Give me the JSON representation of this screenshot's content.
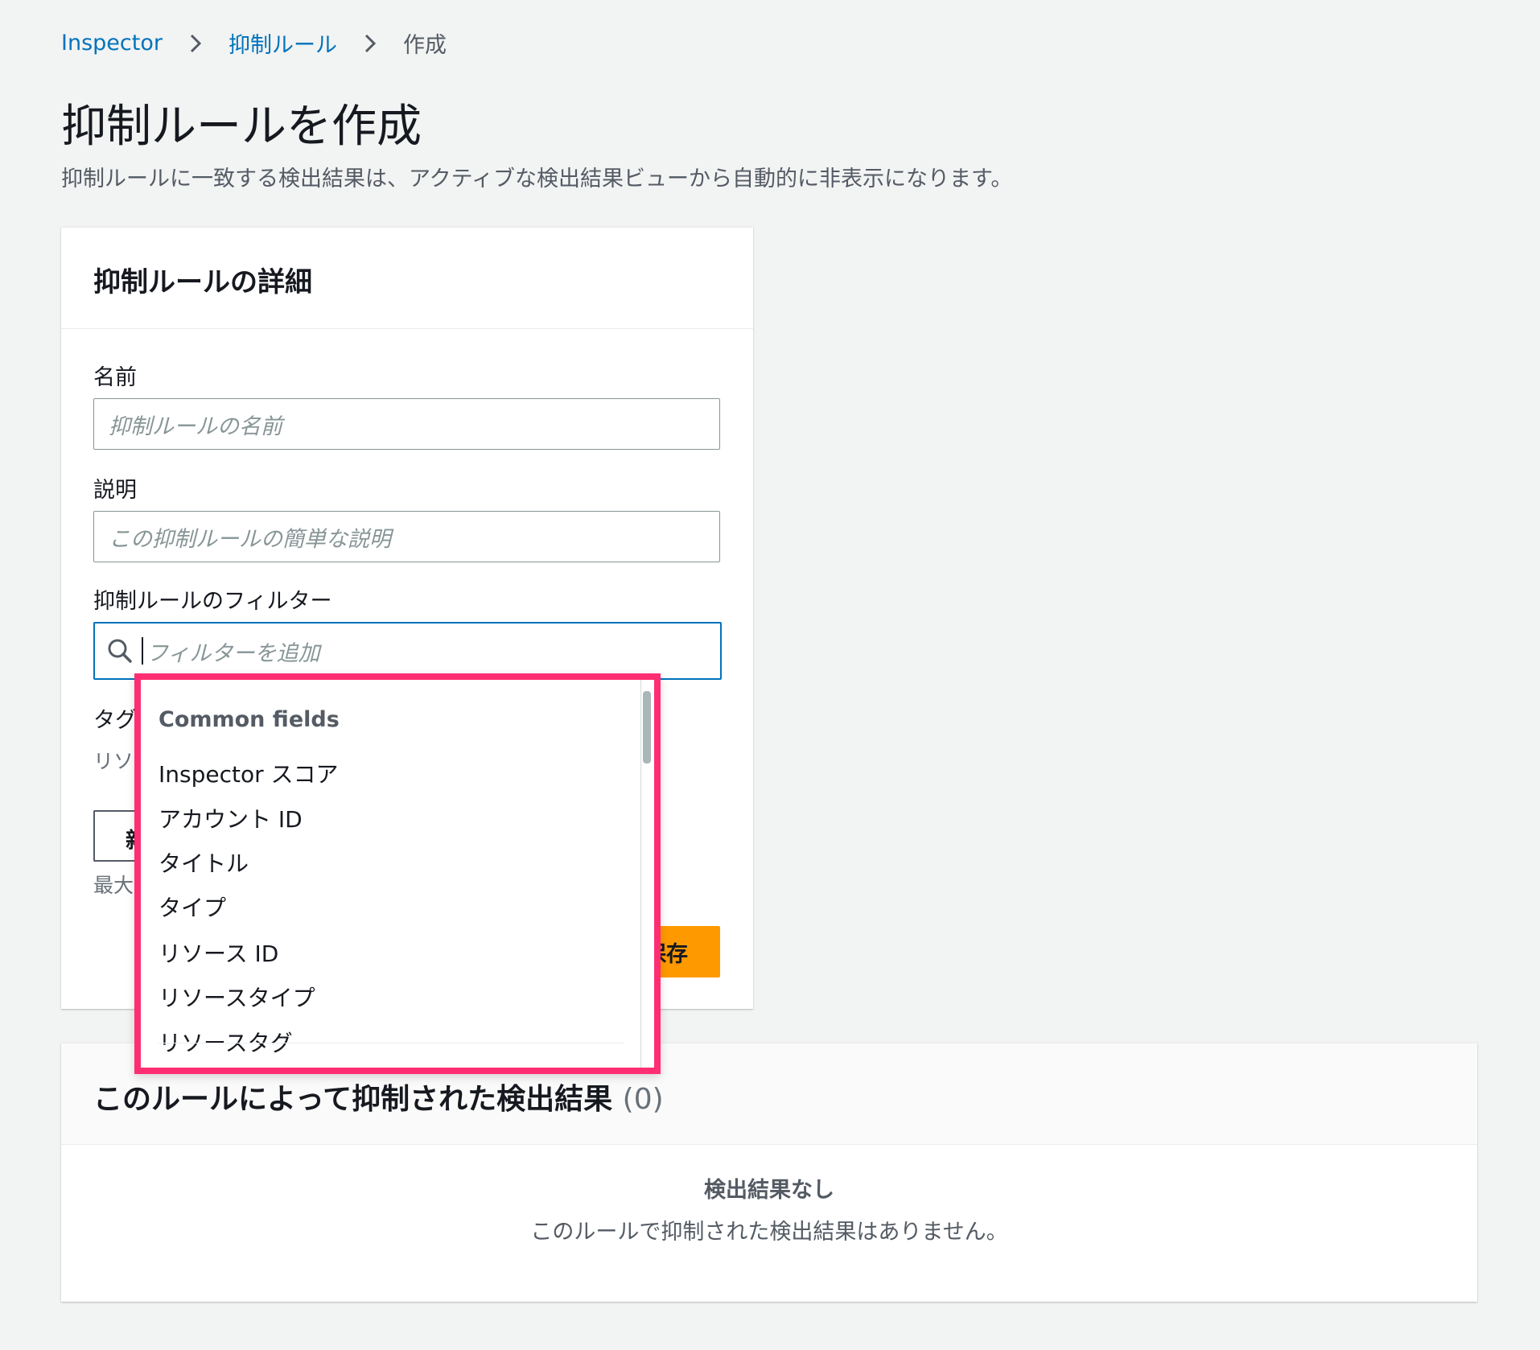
{
  "breadcrumb": {
    "items": [
      "Inspector",
      "抑制ルール",
      "作成"
    ]
  },
  "page": {
    "title": "抑制ルールを作成",
    "description": "抑制ルールに一致する検出結果は、アクティブな検出結果ビューから自動的に非表示になります。"
  },
  "details": {
    "header": "抑制ルールの詳細",
    "name_label": "名前",
    "name_placeholder": "抑制ルールの名前",
    "description_label": "説明",
    "description_placeholder": "この抑制ルールの簡単な説明",
    "filter_label": "抑制ルールのフィルター",
    "filter_placeholder": "フィルターを追加",
    "tags_label_partial": "タグ",
    "tags_desc_partial": "リソ",
    "tags_button_partial": "新",
    "tags_limit_partial": "最大",
    "save_partial": "保存"
  },
  "dropdown": {
    "group": "Common fields",
    "options": [
      "Inspector スコア",
      "アカウント ID",
      "タイトル",
      "タイプ",
      "リソース ID",
      "リソースタイプ",
      "リソースタグ"
    ]
  },
  "results": {
    "title": "このルールによって抑制された検出結果",
    "count": "(0)",
    "empty_title": "検出結果なし",
    "empty_desc": "このルールで抑制された検出結果はありません。"
  },
  "colors": {
    "link": "#0073bb",
    "primary_button": "#ff9900",
    "highlight_border": "#ff2e72",
    "focus_border": "#0073bb"
  }
}
